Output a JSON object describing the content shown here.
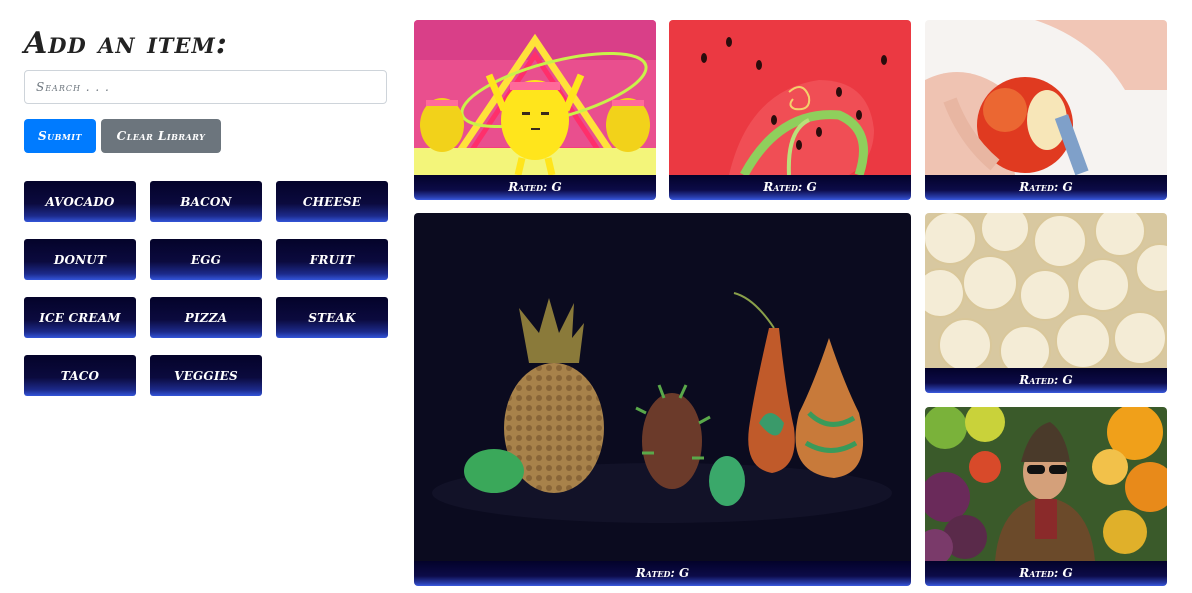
{
  "form": {
    "title": "Add an item:",
    "search_placeholder": "Search . . .",
    "submit_label": "Submit",
    "clear_label": "Clear Library"
  },
  "topics": [
    "avocado",
    "bacon",
    "cheese",
    "donut",
    "egg",
    "fruit",
    "ice cream",
    "pizza",
    "steak",
    "taco",
    "veggies"
  ],
  "gifs": [
    {
      "rating": "Rated: G",
      "icon": "dancing-lemons-image"
    },
    {
      "rating": "Rated: G",
      "icon": "watermelon-image"
    },
    {
      "rating": "Rated: G",
      "icon": "apple-peeling-image"
    },
    {
      "rating": "Rated: G",
      "icon": "fruit-sculptures-image"
    },
    {
      "rating": "Rated: G",
      "icon": "banana-slices-image"
    },
    {
      "rating": "Rated: G",
      "icon": "man-with-fruit-image"
    }
  ]
}
